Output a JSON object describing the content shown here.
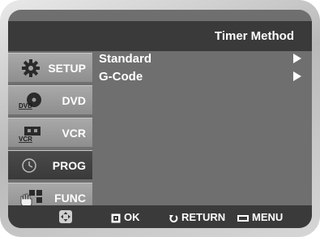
{
  "header": {
    "title": "Timer Method"
  },
  "sidebar": {
    "items": [
      {
        "label": "SETUP",
        "icon": "gear-icon"
      },
      {
        "label": "DVD",
        "icon": "dvd-disc-icon",
        "badge": "DVD"
      },
      {
        "label": "VCR",
        "icon": "vcr-cassette-icon",
        "badge": "VCR"
      },
      {
        "label": "PROG",
        "icon": "clock-icon"
      },
      {
        "label": "FUNC",
        "icon": "func-hand-icon"
      }
    ]
  },
  "menu": {
    "items": [
      {
        "label": "Standard"
      },
      {
        "label": "G-Code"
      }
    ]
  },
  "footer": {
    "ok_label": "OK",
    "return_label": "RETURN",
    "menu_label": "MENU"
  }
}
